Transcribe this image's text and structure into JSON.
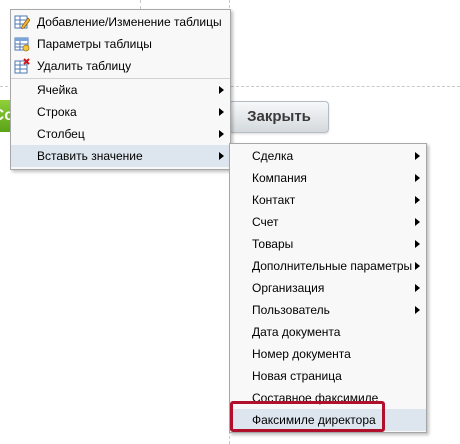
{
  "close_button": {
    "label": "Закрыть"
  },
  "green_button": {
    "label": "Со"
  },
  "context_menu": {
    "items": [
      {
        "label": "Добавление/Изменение таблицы",
        "icon": "table-edit-icon"
      },
      {
        "label": "Параметры таблицы",
        "icon": "table-properties-icon"
      },
      {
        "label": "Удалить таблицу",
        "icon": "table-delete-icon"
      },
      {
        "label": "Ячейка",
        "submenu": true
      },
      {
        "label": "Строка",
        "submenu": true
      },
      {
        "label": "Столбец",
        "submenu": true
      },
      {
        "label": "Вставить значение",
        "submenu": true,
        "highlighted": true
      }
    ]
  },
  "submenu": {
    "items": [
      {
        "label": "Сделка",
        "submenu": true
      },
      {
        "label": "Компания",
        "submenu": true
      },
      {
        "label": "Контакт",
        "submenu": true
      },
      {
        "label": "Счет",
        "submenu": true
      },
      {
        "label": "Товары",
        "submenu": true
      },
      {
        "label": "Дополнительные параметры",
        "submenu": true
      },
      {
        "label": "Организация",
        "submenu": true
      },
      {
        "label": "Пользователь",
        "submenu": true
      },
      {
        "label": "Дата документа"
      },
      {
        "label": "Номер документа"
      },
      {
        "label": "Новая страница"
      },
      {
        "label": "Составное факсимиле"
      },
      {
        "label": "Факсимиле директора",
        "highlighted": true
      }
    ]
  },
  "colors": {
    "highlight": "#dde5ee",
    "callout_border": "#b0102b"
  }
}
